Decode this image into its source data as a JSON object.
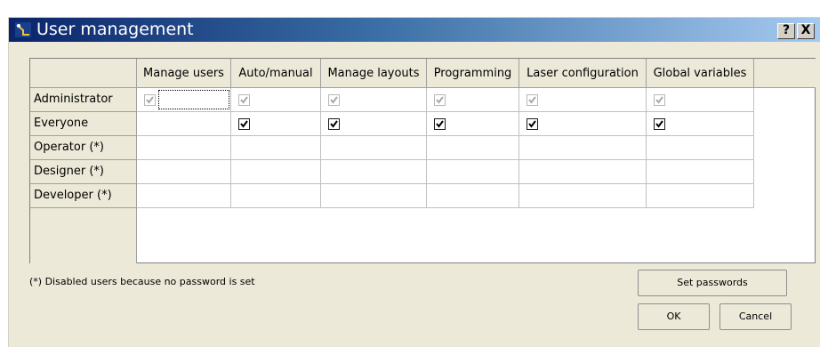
{
  "window": {
    "title": "User management",
    "help_label": "?",
    "close_label": "X"
  },
  "grid": {
    "columns": [
      "Manage users",
      "Auto/manual",
      "Manage layouts",
      "Programming",
      "Laser configuration",
      "Global variables"
    ],
    "rows": [
      {
        "label": "Administrator",
        "cells": [
          "checked-disabled",
          "checked-disabled",
          "checked-disabled",
          "checked-disabled",
          "checked-disabled",
          "checked-disabled"
        ]
      },
      {
        "label": "Everyone",
        "cells": [
          "empty",
          "checked",
          "checked",
          "checked",
          "checked",
          "checked"
        ]
      },
      {
        "label": "Operator (*)",
        "cells": [
          "empty",
          "empty",
          "empty",
          "empty",
          "empty",
          "empty"
        ]
      },
      {
        "label": "Designer (*)",
        "cells": [
          "empty",
          "empty",
          "empty",
          "empty",
          "empty",
          "empty"
        ]
      },
      {
        "label": "Developer (*)",
        "cells": [
          "empty",
          "empty",
          "empty",
          "empty",
          "empty",
          "empty"
        ]
      }
    ]
  },
  "footer": {
    "note": "(*) Disabled users because no password is set",
    "set_passwords_label": "Set passwords",
    "ok_label": "OK",
    "cancel_label": "Cancel"
  },
  "colors": {
    "title_gradient_start": "#0a246a",
    "title_gradient_end": "#a6caf0",
    "dialog_background": "#ece9d8"
  }
}
